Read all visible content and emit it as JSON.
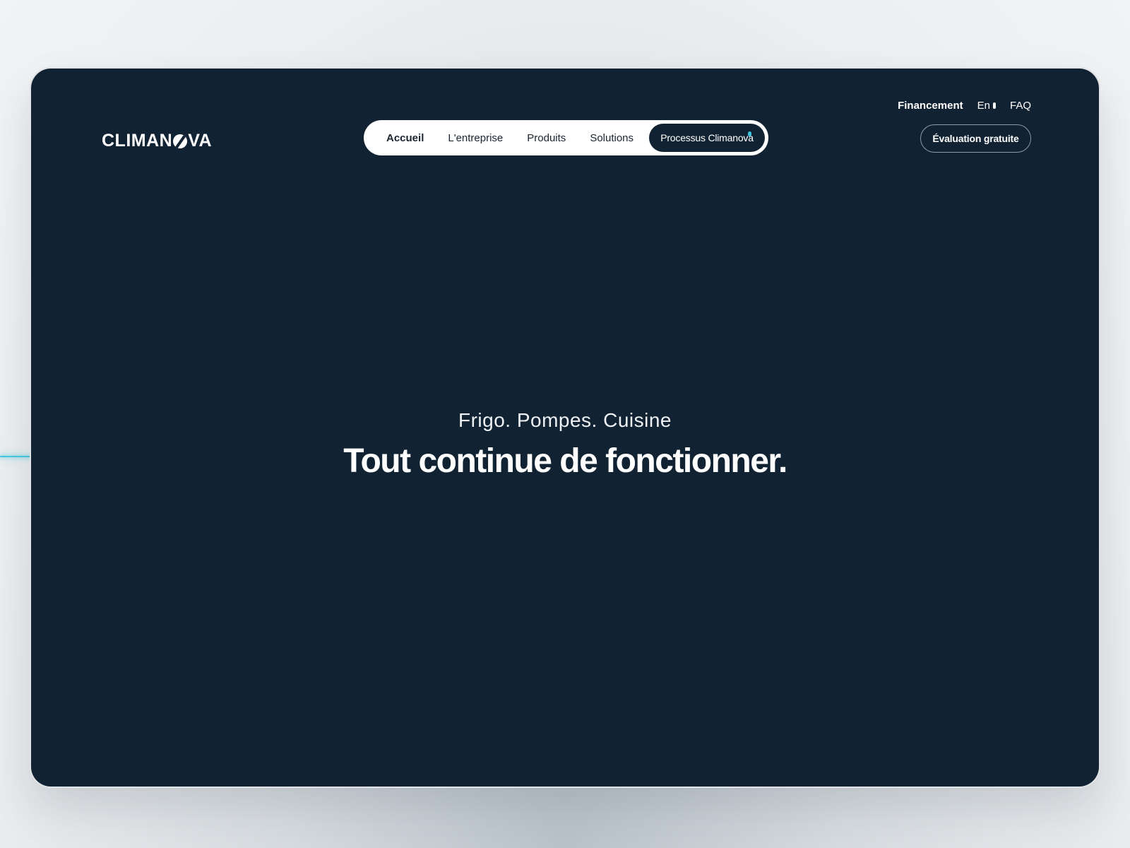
{
  "brand": {
    "name_left": "CLIMAN",
    "name_right": "VA",
    "logo_icon": "slashed-o-icon"
  },
  "nav": {
    "items": [
      {
        "label": "Accueil",
        "active": true
      },
      {
        "label": "L'entreprise",
        "active": false
      },
      {
        "label": "Produits",
        "active": false
      },
      {
        "label": "Solutions",
        "active": false
      }
    ],
    "cta_label": "Processus Climanova"
  },
  "top_links": {
    "financing": "Financement",
    "language": "En",
    "faq": "FAQ"
  },
  "eval_button": {
    "label": "Évaluation gratuite"
  },
  "hero": {
    "subtitle": "Frigo. Pompes. Cuisine",
    "title": "Tout continue de fonctionner."
  },
  "colors": {
    "window_bg": "#112232",
    "accent": "#38c4dc",
    "text": "#ffffff",
    "pill_bg": "#ffffff"
  }
}
